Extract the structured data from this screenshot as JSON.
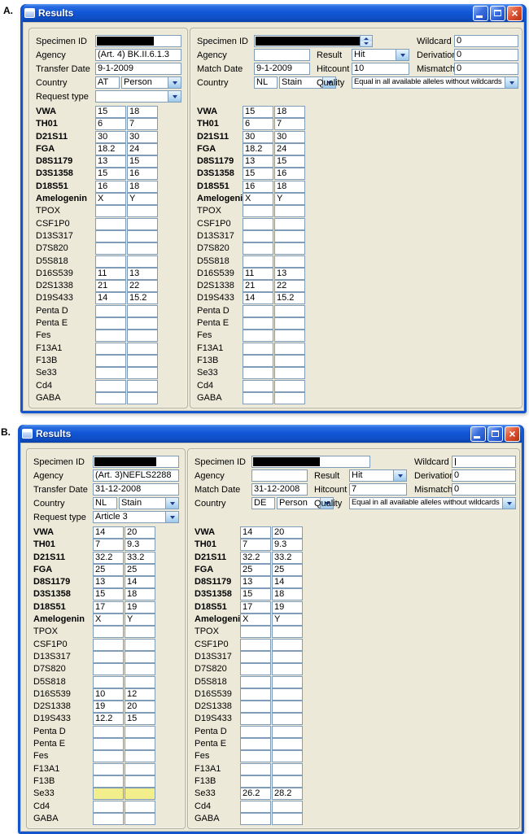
{
  "windows": [
    {
      "corner_label": "A.",
      "title": "Results",
      "left": {
        "fields": {
          "specimen_label": "Specimen ID",
          "agency_label": "Agency",
          "agency_value": "(Art. 4) BK.II.6.1.3",
          "date_label": "Transfer Date",
          "date_value": "9-1-2009",
          "country_label": "Country",
          "country_code": "AT",
          "country_kind": "Person",
          "request_label": "Request type",
          "request_value": ""
        },
        "loci": [
          {
            "name": "VWA",
            "bold": true,
            "a1": "15",
            "a2": "18"
          },
          {
            "name": "TH01",
            "bold": true,
            "a1": "6",
            "a2": "7"
          },
          {
            "name": "D21S11",
            "bold": true,
            "a1": "30",
            "a2": "30"
          },
          {
            "name": "FGA",
            "bold": true,
            "a1": "18.2",
            "a2": "24"
          },
          {
            "name": "D8S1179",
            "bold": true,
            "a1": "13",
            "a2": "15"
          },
          {
            "name": "D3S1358",
            "bold": true,
            "a1": "15",
            "a2": "16"
          },
          {
            "name": "D18S51",
            "bold": true,
            "a1": "16",
            "a2": "18"
          },
          {
            "name": "Amelogenin",
            "bold": true,
            "a1": "X",
            "a2": "Y"
          },
          {
            "name": "TPOX",
            "a1": "",
            "a2": ""
          },
          {
            "name": "CSF1P0",
            "a1": "",
            "a2": ""
          },
          {
            "name": "D13S317",
            "a1": "",
            "a2": ""
          },
          {
            "name": "D7S820",
            "a1": "",
            "a2": ""
          },
          {
            "name": "D5S818",
            "a1": "",
            "a2": ""
          },
          {
            "name": "D16S539",
            "a1": "11",
            "a2": "13"
          },
          {
            "name": "D2S1338",
            "a1": "21",
            "a2": "22"
          },
          {
            "name": "D19S433",
            "a1": "14",
            "a2": "15.2"
          },
          {
            "name": "Penta D",
            "a1": "",
            "a2": ""
          },
          {
            "name": "Penta E",
            "a1": "",
            "a2": ""
          },
          {
            "name": "Fes",
            "a1": "",
            "a2": ""
          },
          {
            "name": "F13A1",
            "a1": "",
            "a2": ""
          },
          {
            "name": "F13B",
            "a1": "",
            "a2": ""
          },
          {
            "name": "Se33",
            "a1": "",
            "a2": ""
          },
          {
            "name": "Cd4",
            "a1": "",
            "a2": ""
          },
          {
            "name": "GABA",
            "a1": "",
            "a2": ""
          }
        ]
      },
      "right": {
        "fields": {
          "specimen_label": "Specimen ID",
          "agency_label": "Agency",
          "agency_value": "",
          "date_label": "Match Date",
          "date_value": "9-1-2009",
          "country_label": "Country",
          "country_code": "NL",
          "country_kind": "Stain",
          "result_label": "Result",
          "result_value": "Hit",
          "hitcount_label": "Hitcount",
          "hitcount_value": "10",
          "quality_label": "Quality",
          "quality_value": "Equal in all available alleles without wildcards",
          "wildcard_label": "Wildcard",
          "wildcard_value": "0",
          "derivation_label": "Derivation",
          "derivation_value": "0",
          "mismatch_label": "Mismatch",
          "mismatch_value": "0"
        },
        "loci": [
          {
            "name": "VWA",
            "bold": true,
            "a1": "15",
            "a2": "18"
          },
          {
            "name": "TH01",
            "bold": true,
            "a1": "6",
            "a2": "7"
          },
          {
            "name": "D21S11",
            "bold": true,
            "a1": "30",
            "a2": "30"
          },
          {
            "name": "FGA",
            "bold": true,
            "a1": "18.2",
            "a2": "24"
          },
          {
            "name": "D8S1179",
            "bold": true,
            "a1": "13",
            "a2": "15"
          },
          {
            "name": "D3S1358",
            "bold": true,
            "a1": "15",
            "a2": "16"
          },
          {
            "name": "D18S51",
            "bold": true,
            "a1": "16",
            "a2": "18"
          },
          {
            "name": "Amelogenin",
            "bold": true,
            "a1": "X",
            "a2": "Y"
          },
          {
            "name": "TPOX",
            "a1": "",
            "a2": ""
          },
          {
            "name": "CSF1P0",
            "a1": "",
            "a2": ""
          },
          {
            "name": "D13S317",
            "a1": "",
            "a2": ""
          },
          {
            "name": "D7S820",
            "a1": "",
            "a2": ""
          },
          {
            "name": "D5S818",
            "a1": "",
            "a2": ""
          },
          {
            "name": "D16S539",
            "a1": "11",
            "a2": "13"
          },
          {
            "name": "D2S1338",
            "a1": "21",
            "a2": "22"
          },
          {
            "name": "D19S433",
            "a1": "14",
            "a2": "15.2"
          },
          {
            "name": "Penta D",
            "a1": "",
            "a2": ""
          },
          {
            "name": "Penta E",
            "a1": "",
            "a2": ""
          },
          {
            "name": "Fes",
            "a1": "",
            "a2": ""
          },
          {
            "name": "F13A1",
            "a1": "",
            "a2": ""
          },
          {
            "name": "F13B",
            "a1": "",
            "a2": ""
          },
          {
            "name": "Se33",
            "a1": "",
            "a2": ""
          },
          {
            "name": "Cd4",
            "a1": "",
            "a2": ""
          },
          {
            "name": "GABA",
            "a1": "",
            "a2": ""
          }
        ]
      }
    },
    {
      "corner_label": "B.",
      "title": "Results",
      "left": {
        "fields": {
          "specimen_label": "Specimen ID",
          "agency_label": "Agency",
          "agency_value": "(Art. 3)NEFLS2288",
          "date_label": "Transfer Date",
          "date_value": "31-12-2008",
          "country_label": "Country",
          "country_code": "NL",
          "country_kind": "Stain",
          "request_label": "Request type",
          "request_value": "Article 3"
        },
        "loci": [
          {
            "name": "VWA",
            "bold": true,
            "a1": "14",
            "a2": "20"
          },
          {
            "name": "TH01",
            "bold": true,
            "a1": "7",
            "a2": "9.3"
          },
          {
            "name": "D21S11",
            "bold": true,
            "a1": "32.2",
            "a2": "33.2"
          },
          {
            "name": "FGA",
            "bold": true,
            "a1": "25",
            "a2": "25"
          },
          {
            "name": "D8S1179",
            "bold": true,
            "a1": "13",
            "a2": "14"
          },
          {
            "name": "D3S1358",
            "bold": true,
            "a1": "15",
            "a2": "18"
          },
          {
            "name": "D18S51",
            "bold": true,
            "a1": "17",
            "a2": "19"
          },
          {
            "name": "Amelogenin",
            "bold": true,
            "a1": "X",
            "a2": "Y"
          },
          {
            "name": "TPOX",
            "a1": "",
            "a2": ""
          },
          {
            "name": "CSF1P0",
            "a1": "",
            "a2": ""
          },
          {
            "name": "D13S317",
            "a1": "",
            "a2": ""
          },
          {
            "name": "D7S820",
            "a1": "",
            "a2": ""
          },
          {
            "name": "D5S818",
            "a1": "",
            "a2": ""
          },
          {
            "name": "D16S539",
            "a1": "10",
            "a2": "12"
          },
          {
            "name": "D2S1338",
            "a1": "19",
            "a2": "20"
          },
          {
            "name": "D19S433",
            "a1": "12.2",
            "a2": "15"
          },
          {
            "name": "Penta D",
            "a1": "",
            "a2": ""
          },
          {
            "name": "Penta E",
            "a1": "",
            "a2": ""
          },
          {
            "name": "Fes",
            "a1": "",
            "a2": ""
          },
          {
            "name": "F13A1",
            "a1": "",
            "a2": ""
          },
          {
            "name": "F13B",
            "a1": "",
            "a2": ""
          },
          {
            "name": "Se33",
            "a1": "",
            "a2": "",
            "highlight": true
          },
          {
            "name": "Cd4",
            "a1": "",
            "a2": ""
          },
          {
            "name": "GABA",
            "a1": "",
            "a2": ""
          }
        ]
      },
      "right": {
        "fields": {
          "specimen_label": "Specimen ID",
          "agency_label": "Agency",
          "agency_value": "",
          "date_label": "Match Date",
          "date_value": "31-12-2008",
          "country_label": "Country",
          "country_code": "DE",
          "country_kind": "Person",
          "result_label": "Result",
          "result_value": "Hit",
          "hitcount_label": "Hitcount",
          "hitcount_value": "7",
          "quality_label": "Quality",
          "quality_value": "Equal in all available alleles without wildcards",
          "wildcard_label": "Wildcard",
          "wildcard_value": "",
          "derivation_label": "Derivation",
          "derivation_value": "0",
          "mismatch_label": "Mismatch",
          "mismatch_value": "0"
        },
        "loci": [
          {
            "name": "VWA",
            "bold": true,
            "a1": "14",
            "a2": "20"
          },
          {
            "name": "TH01",
            "bold": true,
            "a1": "7",
            "a2": "9.3"
          },
          {
            "name": "D21S11",
            "bold": true,
            "a1": "32.2",
            "a2": "33.2"
          },
          {
            "name": "FGA",
            "bold": true,
            "a1": "25",
            "a2": "25"
          },
          {
            "name": "D8S1179",
            "bold": true,
            "a1": "13",
            "a2": "14"
          },
          {
            "name": "D3S1358",
            "bold": true,
            "a1": "15",
            "a2": "18"
          },
          {
            "name": "D18S51",
            "bold": true,
            "a1": "17",
            "a2": "19"
          },
          {
            "name": "Amelogenin",
            "bold": true,
            "a1": "X",
            "a2": "Y"
          },
          {
            "name": "TPOX",
            "a1": "",
            "a2": ""
          },
          {
            "name": "CSF1P0",
            "a1": "",
            "a2": ""
          },
          {
            "name": "D13S317",
            "a1": "",
            "a2": ""
          },
          {
            "name": "D7S820",
            "a1": "",
            "a2": ""
          },
          {
            "name": "D5S818",
            "a1": "",
            "a2": ""
          },
          {
            "name": "D16S539",
            "a1": "",
            "a2": ""
          },
          {
            "name": "D2S1338",
            "a1": "",
            "a2": ""
          },
          {
            "name": "D19S433",
            "a1": "",
            "a2": ""
          },
          {
            "name": "Penta D",
            "a1": "",
            "a2": ""
          },
          {
            "name": "Penta E",
            "a1": "",
            "a2": ""
          },
          {
            "name": "Fes",
            "a1": "",
            "a2": ""
          },
          {
            "name": "F13A1",
            "a1": "",
            "a2": ""
          },
          {
            "name": "F13B",
            "a1": "",
            "a2": ""
          },
          {
            "name": "Se33",
            "a1": "26.2",
            "a2": "28.2"
          },
          {
            "name": "Cd4",
            "a1": "",
            "a2": ""
          },
          {
            "name": "GABA",
            "a1": "",
            "a2": ""
          }
        ]
      }
    }
  ]
}
